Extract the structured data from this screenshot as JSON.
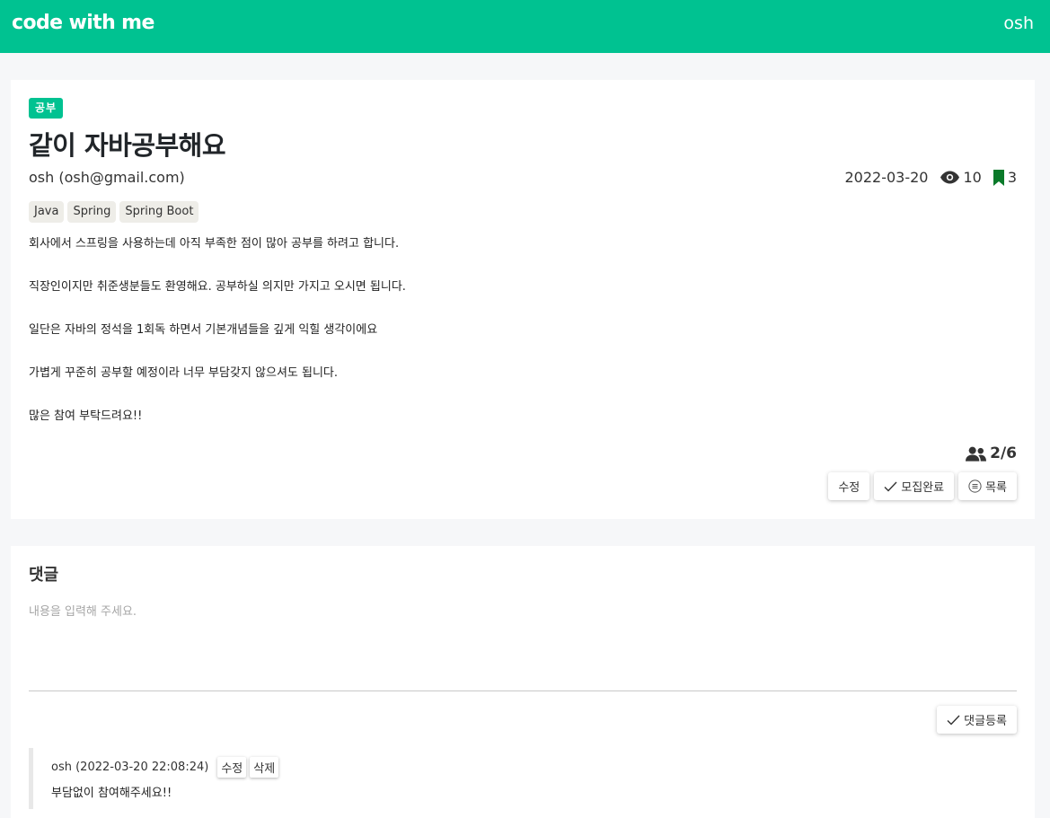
{
  "header": {
    "brand": "code with me",
    "user": "osh"
  },
  "post": {
    "category": "공부",
    "title": "같이 자바공부해요",
    "author": "osh (osh@gmail.com)",
    "date": "2022-03-20",
    "views": "10",
    "bookmarks": "3",
    "tags": [
      "Java",
      "Spring",
      "Spring Boot"
    ],
    "paragraphs": [
      "회사에서 스프링을 사용하는데 아직 부족한 점이 많아 공부를 하려고 합니다.",
      "직장인이지만 취준생분들도 환영해요. 공부하실 의지만 가지고 오시면 됩니다.",
      "일단은 자바의 정석을 1회독 하면서 기본개념들을 깊게 익힐 생각이에요",
      "가볍게 꾸준히 공부할 예정이라 너무 부담갖지 않으셔도 됩니다.",
      "많은 참여 부탁드려요!!"
    ],
    "members": "2/6",
    "buttons": {
      "edit": "수정",
      "close": "모집완료",
      "list": "목록"
    }
  },
  "comments": {
    "title": "댓글",
    "placeholder": "내용을 입력해 주세요.",
    "submit": "댓글등록",
    "items": [
      {
        "meta": "osh (2022-03-20 22:08:24)",
        "edit": "수정",
        "delete": "삭제",
        "text": "부담없이 참여해주세요!!"
      }
    ]
  },
  "colors": {
    "brand": "#00c291",
    "bookmark": "#0a7a2a"
  }
}
